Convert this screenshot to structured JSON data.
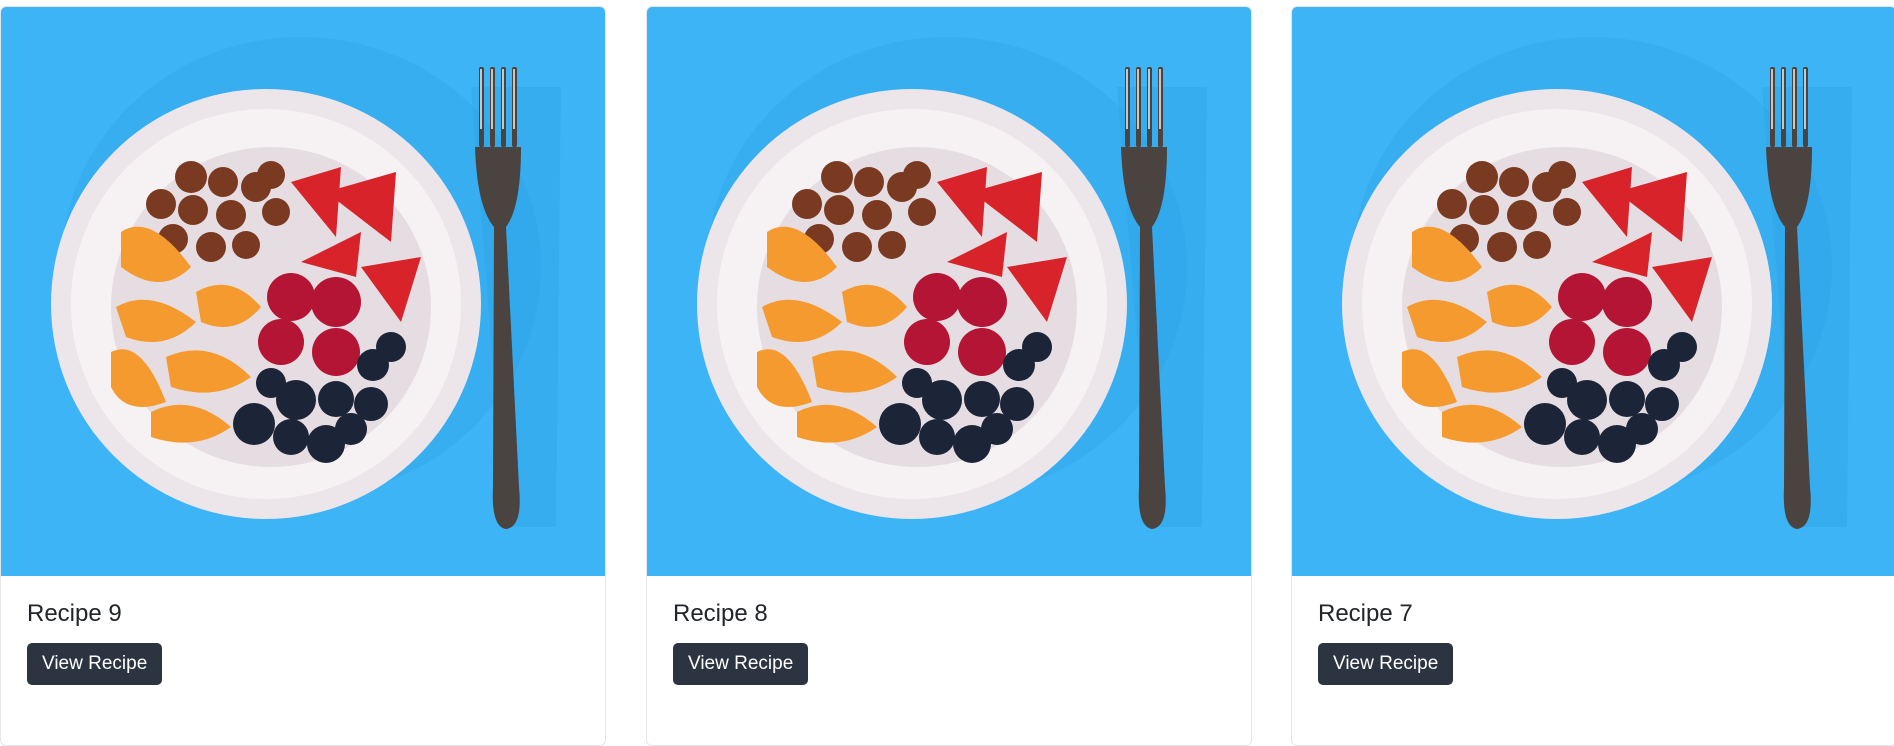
{
  "colors": {
    "photo_background": "#3db4f5",
    "button": "#2d3441",
    "title_text": "#212529"
  },
  "cards": [
    {
      "title": "Recipe 9",
      "button_label": "View Recipe",
      "image": "bowl-of-fruit-and-nuts-photo"
    },
    {
      "title": "Recipe 8",
      "button_label": "View Recipe",
      "image": "bowl-of-fruit-and-nuts-photo"
    },
    {
      "title": "Recipe 7",
      "button_label": "View Recipe",
      "image": "bowl-of-fruit-and-nuts-photo"
    }
  ]
}
